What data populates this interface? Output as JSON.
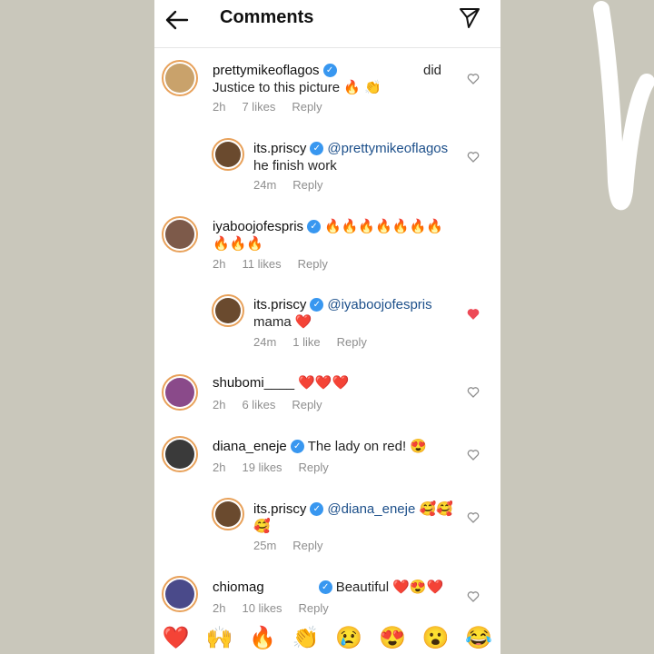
{
  "header": {
    "title": "Comments",
    "back_icon": "arrow-left-icon",
    "share_icon": "send-icon"
  },
  "comments": [
    {
      "username": "prettymikeoflagos",
      "text_line1_extra": "did",
      "text": "Justice to this picture 🔥 👏",
      "time": "2h",
      "likes": "7 likes",
      "reply": "Reply",
      "liked": false,
      "avatar_color": "#c9a26b"
    },
    {
      "username": "its.priscy",
      "mention": "@prettymikeoflagos",
      "text": "he finish work",
      "time": "24m",
      "reply": "Reply",
      "liked": false,
      "avatar_color": "#6a4a2e"
    },
    {
      "username": "iyaboojofespris",
      "text_inline": "🔥🔥🔥🔥🔥🔥🔥",
      "text": "🔥🔥🔥",
      "time": "2h",
      "likes": "11 likes",
      "reply": "Reply",
      "liked": false,
      "avatar_color": "#7d5a4a"
    },
    {
      "username": "its.priscy",
      "mention": "@iyaboojofespris",
      "text": "mama ❤️",
      "time": "24m",
      "likes": "1 like",
      "reply": "Reply",
      "liked": true,
      "avatar_color": "#6a4a2e"
    },
    {
      "username": "shubomi____",
      "text_inline": "❤️❤️❤️",
      "time": "2h",
      "likes": "6 likes",
      "reply": "Reply",
      "liked": false,
      "avatar_color": "#8a4a8a"
    },
    {
      "username": "diana_eneje",
      "text_inline": "The lady on red! 😍",
      "time": "2h",
      "likes": "19 likes",
      "reply": "Reply",
      "liked": false,
      "avatar_color": "#3a3a3a"
    },
    {
      "username": "its.priscy",
      "mention": "@diana_eneje 🥰🥰",
      "text": "🥰",
      "time": "25m",
      "reply": "Reply",
      "liked": false,
      "avatar_color": "#6a4a2e"
    },
    {
      "username": "chiomag",
      "text_inline": "Beautiful ❤️😍❤️",
      "time": "2h",
      "likes": "10 likes",
      "reply": "Reply",
      "liked": false,
      "avatar_color": "#4a4a8a"
    }
  ],
  "emoji_bar": [
    "❤️",
    "🙌",
    "🔥",
    "👏",
    "😢",
    "😍",
    "😮",
    "😂"
  ],
  "colors": {
    "heart_liked": "#ed4956",
    "verified": "#3897f0",
    "mention": "#1c4f8a"
  }
}
